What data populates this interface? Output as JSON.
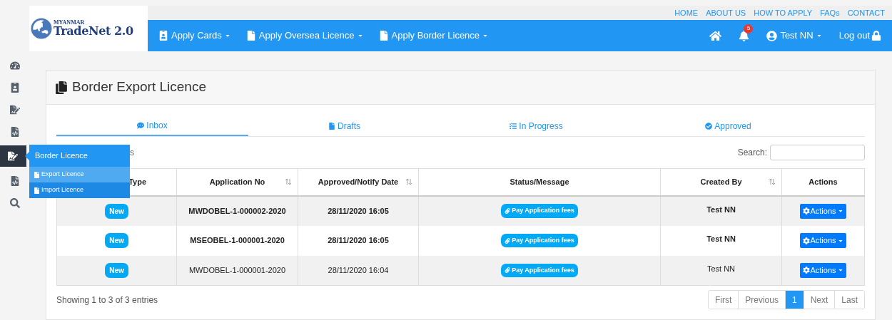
{
  "logo": {
    "small": "MYANMAR",
    "title": "TradeNet 2.0"
  },
  "top_links": [
    "HOME",
    "ABOUT US",
    "HOW TO APPLY",
    "FAQs",
    "CONTACT"
  ],
  "nav": [
    {
      "label": "Apply Cards"
    },
    {
      "label": "Apply Oversea Licence"
    },
    {
      "label": "Apply Border Licence"
    }
  ],
  "notifications": "5",
  "user": "Test NN",
  "logout": "Log out",
  "sidebar": [
    {
      "selected": false
    },
    {
      "selected": false
    },
    {
      "selected": false
    },
    {
      "selected": false
    },
    {
      "selected": true
    },
    {
      "selected": false
    },
    {
      "selected": false
    }
  ],
  "flyout": {
    "title": "Border Licence",
    "items": [
      {
        "label": "Export Licence",
        "selected": true
      },
      {
        "label": "Import Licence",
        "selected": false
      }
    ]
  },
  "page_title": "Border Export Licence",
  "tabs": [
    {
      "label": "Inbox",
      "selected": true
    },
    {
      "label": "Drafts",
      "selected": false
    },
    {
      "label": "In Progress",
      "selected": false
    },
    {
      "label": "Approved",
      "selected": false
    }
  ],
  "length_fragment": "s",
  "search_label": "Search:",
  "table": {
    "columns": [
      {
        "label": "Type",
        "sortable": false
      },
      {
        "label": "Application No",
        "sortable": true
      },
      {
        "label": "Approved/Notify Date",
        "sortable": true
      },
      {
        "label": "Status/Message",
        "sortable": false
      },
      {
        "label": "Created By",
        "sortable": true
      },
      {
        "label": "Actions",
        "sortable": false
      }
    ],
    "rows": [
      {
        "type": "New",
        "app_no": "MWDOBEL-1-000002-2020",
        "date": "28/11/2020 16:05",
        "status": "Pay Application fees",
        "created_by": "Test NN",
        "action": "Actions",
        "unread": true
      },
      {
        "type": "New",
        "app_no": "MSEOBEL-1-000001-2020",
        "date": "28/11/2020 16:05",
        "status": "Pay Application fees",
        "created_by": "Test NN",
        "action": "Actions",
        "unread": true
      },
      {
        "type": "New",
        "app_no": "MWDOBEL-1-000001-2020",
        "date": "28/11/2020 16:04",
        "status": "Pay Application fees",
        "created_by": "Test NN",
        "action": "Actions",
        "unread": false
      }
    ]
  },
  "info": "Showing 1 to 3 of 3 entries",
  "pagination": [
    {
      "label": "First",
      "selected": false
    },
    {
      "label": "Previous",
      "selected": false
    },
    {
      "label": "1",
      "selected": true
    },
    {
      "label": "Next",
      "selected": false
    },
    {
      "label": "Last",
      "selected": false
    }
  ]
}
